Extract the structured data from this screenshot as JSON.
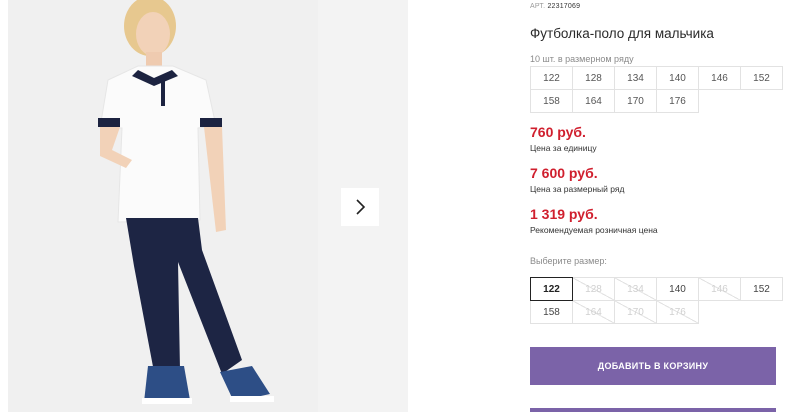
{
  "product": {
    "article_label": "АРТ.",
    "article_value": "22317069",
    "title": "Футболка-поло для мальчика"
  },
  "series": {
    "caption": "10 шт. в размерном ряду",
    "sizes": [
      "122",
      "128",
      "134",
      "140",
      "146",
      "152",
      "158",
      "164",
      "170",
      "176"
    ]
  },
  "prices": {
    "unit_price": "760 руб.",
    "unit_note": "Цена за единицу",
    "series_price": "7 600 руб.",
    "series_note": "Цена за размерный ряд",
    "retail_price": "1 319 руб.",
    "retail_note": "Рекомендуемая розничная цена",
    "accent_color": "#d01f2e"
  },
  "size_select": {
    "caption": "Выберите размер:",
    "options": [
      {
        "label": "122",
        "state": "selected"
      },
      {
        "label": "128",
        "state": "disabled"
      },
      {
        "label": "134",
        "state": "disabled"
      },
      {
        "label": "140",
        "state": "available"
      },
      {
        "label": "146",
        "state": "disabled"
      },
      {
        "label": "152",
        "state": "available"
      },
      {
        "label": "158",
        "state": "available"
      },
      {
        "label": "164",
        "state": "disabled"
      },
      {
        "label": "170",
        "state": "disabled"
      },
      {
        "label": "176",
        "state": "disabled"
      }
    ]
  },
  "actions": {
    "add_to_cart_label": "ДОБАВИТЬ В КОРЗИНУ",
    "button_color": "#7b63a8"
  },
  "gallery": {
    "next_icon": "chevron-right-icon"
  }
}
